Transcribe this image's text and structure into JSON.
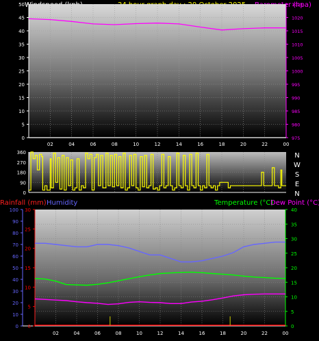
{
  "header": {
    "left_label": "Windspeed (kph)",
    "center_label": "24 hour graph day : 20 October 2025",
    "right_label": "Barometer (hpa)"
  },
  "x_ticks": [
    "02",
    "04",
    "06",
    "08",
    "10",
    "12",
    "14",
    "16",
    "18",
    "20",
    "22",
    "00"
  ],
  "colors": {
    "windspeed": "#ffffff",
    "barometer": "#ff00ff",
    "direction": "#ffff00",
    "humidity": "#6666ff",
    "temperature": "#00ff00",
    "dewpoint": "#ff00ff",
    "rainfall": "#ff0000"
  },
  "panel2": {
    "left_ticks": [
      "360",
      "270",
      "180",
      "90",
      "0"
    ],
    "compass": [
      "N",
      "W",
      "S",
      "E",
      "N"
    ]
  },
  "panel3": {
    "rain_label": "Rainfall (mm)",
    "humidity_label": "Humidity",
    "temp_label": "Temperature (°C)",
    "dew_label": "Dew Point (°C)",
    "humidity_ticks": [
      "100",
      "90",
      "80",
      "70",
      "60",
      "50",
      "40",
      "30",
      "20",
      "10",
      "0"
    ],
    "rain_ticks": [
      "30",
      "25",
      "20",
      "15",
      "10",
      "5",
      "0"
    ],
    "temp_ticks": [
      "40",
      "35",
      "30",
      "25",
      "20",
      "15",
      "10",
      "5",
      "0"
    ]
  },
  "chart_data": [
    {
      "type": "line",
      "title": "24 hour graph day : 20 October 2025",
      "x": [
        "00",
        "02",
        "04",
        "06",
        "08",
        "10",
        "12",
        "14",
        "16",
        "18",
        "20",
        "22",
        "00"
      ],
      "series": [
        {
          "name": "Windspeed (kph)",
          "axis": "left",
          "values": [
            0,
            0,
            0,
            0,
            0,
            0,
            0,
            0,
            0,
            0,
            0,
            0,
            0
          ]
        },
        {
          "name": "Barometer (hpa)",
          "axis": "right",
          "values": [
            1019.5,
            1019.2,
            1018.5,
            1017.6,
            1017.3,
            1017.7,
            1017.9,
            1017.6,
            1016.4,
            1015.3,
            1015.8,
            1016.1,
            1016.1
          ]
        }
      ],
      "ylabel_left": "Windspeed (kph)",
      "ylim_left": [
        0,
        50
      ],
      "ylabel_right": "Barometer (hpa)",
      "ylim_right": [
        975,
        1025
      ],
      "left_ticks": [
        0,
        5,
        10,
        15,
        20,
        25,
        30,
        35,
        40,
        45,
        50
      ],
      "right_ticks": [
        975,
        980,
        985,
        990,
        995,
        1000,
        1005,
        1010,
        1015,
        1020,
        1025
      ]
    },
    {
      "type": "line",
      "series": [
        {
          "name": "Wind direction",
          "values": [
            [
              0,
              20
            ],
            [
              0.2,
              360
            ],
            [
              0.4,
              300
            ],
            [
              0.6,
              330
            ],
            [
              0.8,
              200
            ],
            [
              1.0,
              340
            ],
            [
              1.2,
              320
            ],
            [
              1.3,
              20
            ],
            [
              1.5,
              60
            ],
            [
              1.7,
              20
            ],
            [
              2.0,
              300
            ],
            [
              2.1,
              40
            ],
            [
              2.3,
              350
            ],
            [
              2.5,
              90
            ],
            [
              2.7,
              310
            ],
            [
              2.9,
              30
            ],
            [
              3.1,
              330
            ],
            [
              3.3,
              20
            ],
            [
              3.5,
              310
            ],
            [
              3.7,
              60
            ],
            [
              3.9,
              290
            ],
            [
              4.1,
              20
            ],
            [
              4.3,
              40
            ],
            [
              4.5,
              300
            ],
            [
              4.7,
              20
            ],
            [
              4.9,
              60
            ],
            [
              5.1,
              40
            ],
            [
              5.3,
              350
            ],
            [
              5.5,
              300
            ],
            [
              5.7,
              340
            ],
            [
              5.9,
              20
            ],
            [
              6.1,
              310
            ],
            [
              6.3,
              340
            ],
            [
              6.5,
              60
            ],
            [
              6.7,
              330
            ],
            [
              6.9,
              40
            ],
            [
              7.0,
              40
            ],
            [
              7.2,
              350
            ],
            [
              7.4,
              60
            ],
            [
              7.6,
              330
            ],
            [
              7.8,
              50
            ],
            [
              8.0,
              340
            ],
            [
              8.2,
              60
            ],
            [
              8.4,
              320
            ],
            [
              8.6,
              40
            ],
            [
              8.8,
              350
            ],
            [
              9.0,
              20
            ],
            [
              9.2,
              40
            ],
            [
              9.4,
              330
            ],
            [
              9.6,
              60
            ],
            [
              9.8,
              340
            ],
            [
              10.0,
              40
            ],
            [
              10.2,
              20
            ],
            [
              10.4,
              320
            ],
            [
              10.6,
              50
            ],
            [
              10.8,
              330
            ],
            [
              11.0,
              40
            ],
            [
              11.2,
              60
            ],
            [
              11.4,
              340
            ],
            [
              11.6,
              30
            ],
            [
              11.8,
              40
            ],
            [
              12.0,
              20
            ],
            [
              12.2,
              60
            ],
            [
              12.4,
              340
            ],
            [
              12.6,
              40
            ],
            [
              12.8,
              60
            ],
            [
              13.0,
              320
            ],
            [
              13.2,
              60
            ],
            [
              13.4,
              20
            ],
            [
              13.6,
              40
            ],
            [
              13.8,
              350
            ],
            [
              14.0,
              60
            ],
            [
              14.2,
              40
            ],
            [
              14.4,
              330
            ],
            [
              14.6,
              60
            ],
            [
              14.8,
              20
            ],
            [
              15.0,
              340
            ],
            [
              15.2,
              60
            ],
            [
              15.4,
              40
            ],
            [
              15.6,
              350
            ],
            [
              15.8,
              60
            ],
            [
              16.0,
              20
            ],
            [
              16.2,
              60
            ],
            [
              16.4,
              40
            ],
            [
              16.6,
              340
            ],
            [
              16.8,
              60
            ],
            [
              17.0,
              40
            ],
            [
              17.2,
              60
            ],
            [
              17.4,
              20
            ],
            [
              17.6,
              60
            ],
            [
              17.8,
              90
            ],
            [
              18.0,
              90
            ],
            [
              18.4,
              90
            ],
            [
              18.6,
              40
            ],
            [
              18.8,
              60
            ],
            [
              19.0,
              60
            ],
            [
              19.4,
              60
            ],
            [
              19.8,
              60
            ],
            [
              20.0,
              60
            ],
            [
              20.4,
              60
            ],
            [
              21.0,
              60
            ],
            [
              21.4,
              60
            ],
            [
              21.7,
              180
            ],
            [
              21.9,
              60
            ],
            [
              22.2,
              60
            ],
            [
              22.5,
              60
            ],
            [
              22.7,
              220
            ],
            [
              22.9,
              60
            ],
            [
              23.1,
              60
            ],
            [
              23.3,
              40
            ],
            [
              23.5,
              200
            ],
            [
              23.6,
              60
            ],
            [
              23.8,
              60
            ],
            [
              24.0,
              60
            ]
          ]
        }
      ],
      "ylim": [
        0,
        360
      ],
      "y_ticks": [
        0,
        90,
        180,
        270,
        360
      ],
      "compass_labels": [
        "N",
        "W",
        "S",
        "E",
        "N"
      ]
    },
    {
      "type": "line",
      "series": [
        {
          "name": "Humidity",
          "axis": "humidity",
          "values": [
            71,
            71,
            70,
            69,
            68,
            68,
            70,
            70,
            69,
            67,
            64,
            61,
            61,
            58,
            55,
            55,
            56,
            58,
            60,
            63,
            68,
            70,
            71,
            72,
            72
          ]
        },
        {
          "name": "Temperature (°C)",
          "axis": "temperature",
          "values": [
            16.3,
            16.1,
            15.4,
            14.2,
            14.1,
            14.0,
            14.3,
            14.8,
            15.5,
            16.2,
            16.9,
            17.5,
            18.0,
            18.2,
            18.4,
            18.5,
            18.3,
            18.0,
            17.8,
            17.5,
            17.1,
            16.8,
            16.6,
            16.4,
            16.3
          ]
        },
        {
          "name": "Dew Point (°C)",
          "axis": "temperature",
          "values": [
            9.3,
            9.1,
            8.9,
            8.7,
            8.3,
            8.0,
            7.8,
            7.4,
            7.6,
            8.1,
            8.3,
            8.1,
            8.0,
            7.7,
            7.7,
            8.2,
            8.5,
            9.0,
            9.6,
            10.3,
            10.7,
            10.9,
            11.0,
            11.0,
            11.0
          ]
        },
        {
          "name": "Rainfall (mm)",
          "axis": "rain",
          "values": [
            0,
            0,
            0,
            0,
            0,
            0,
            0,
            0,
            0,
            0,
            0,
            0,
            0,
            0,
            0,
            0,
            0,
            0,
            0,
            0,
            0,
            0,
            0,
            0,
            0
          ]
        }
      ],
      "x": [
        0,
        1,
        2,
        3,
        4,
        5,
        6,
        7,
        8,
        9,
        10,
        11,
        12,
        13,
        14,
        15,
        16,
        17,
        18,
        19,
        20,
        21,
        22,
        23,
        24
      ],
      "ylim_humidity": [
        0,
        100
      ],
      "ylim_rain": [
        0,
        30
      ],
      "ylim_temperature": [
        0,
        40
      ],
      "rain_markers_x": [
        7.2,
        18.7
      ]
    }
  ]
}
